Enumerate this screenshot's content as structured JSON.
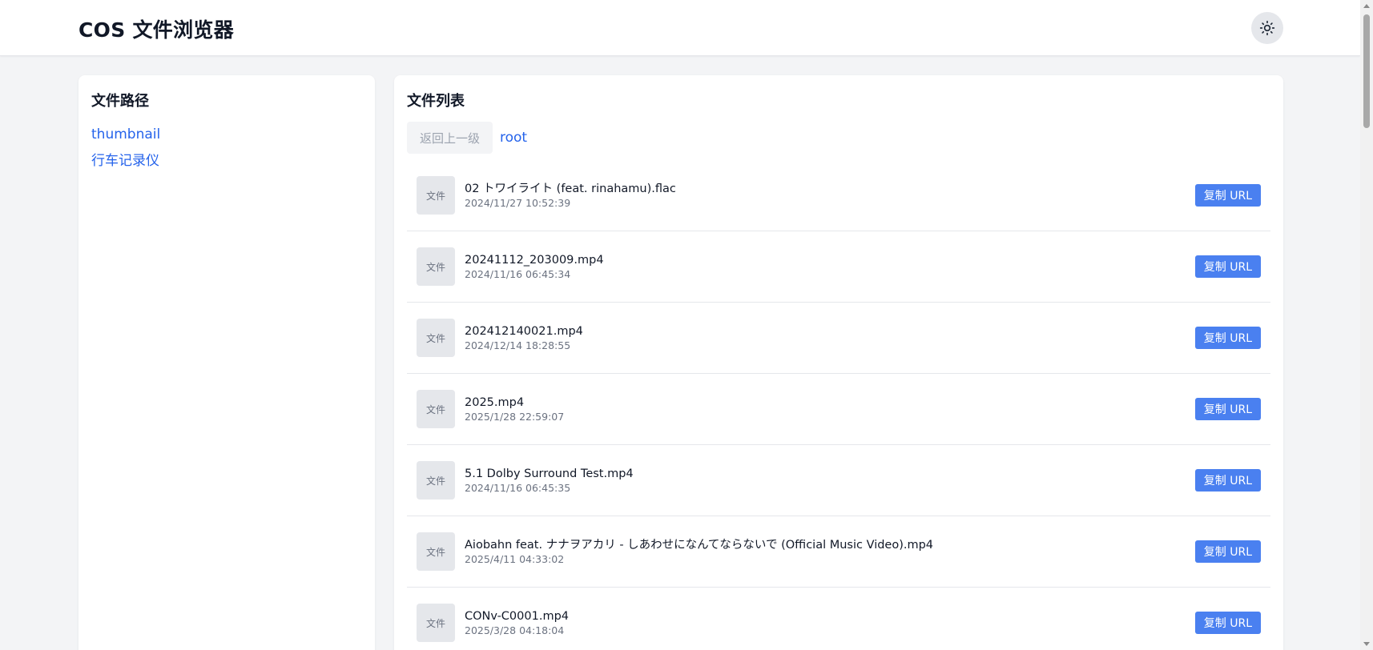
{
  "header": {
    "title": "COS 文件浏览器",
    "theme_toggle_icon": "sun-icon"
  },
  "sidebar": {
    "title": "文件路径",
    "folders": [
      {
        "label": "thumbnail"
      },
      {
        "label": "行车记录仪"
      }
    ]
  },
  "main": {
    "title": "文件列表",
    "back_label": "返回上一级",
    "current_path": "root",
    "files": [
      {
        "thumb": "文件",
        "name": "02 トワイライト (feat. rinahamu).flac",
        "time": "2024/11/27 10:52:39",
        "action": "复制 URL"
      },
      {
        "thumb": "文件",
        "name": "20241112_203009.mp4",
        "time": "2024/11/16 06:45:34",
        "action": "复制 URL"
      },
      {
        "thumb": "文件",
        "name": "202412140021.mp4",
        "time": "2024/12/14 18:28:55",
        "action": "复制 URL"
      },
      {
        "thumb": "文件",
        "name": "2025.mp4",
        "time": "2025/1/28 22:59:07",
        "action": "复制 URL"
      },
      {
        "thumb": "文件",
        "name": "5.1 Dolby Surround Test.mp4",
        "time": "2024/11/16 06:45:35",
        "action": "复制 URL"
      },
      {
        "thumb": "文件",
        "name": "Aiobahn feat. ナナヲアカリ - しあわせになんてならないで (Official Music Video).mp4",
        "time": "2025/4/11 04:33:02",
        "action": "复制 URL"
      },
      {
        "thumb": "文件",
        "name": "CONv-C0001.mp4",
        "time": "2025/3/28 04:18:04",
        "action": "复制 URL"
      }
    ]
  },
  "colors": {
    "accent": "#2563eb",
    "button": "#4a80f0",
    "background": "#f3f4f6"
  }
}
